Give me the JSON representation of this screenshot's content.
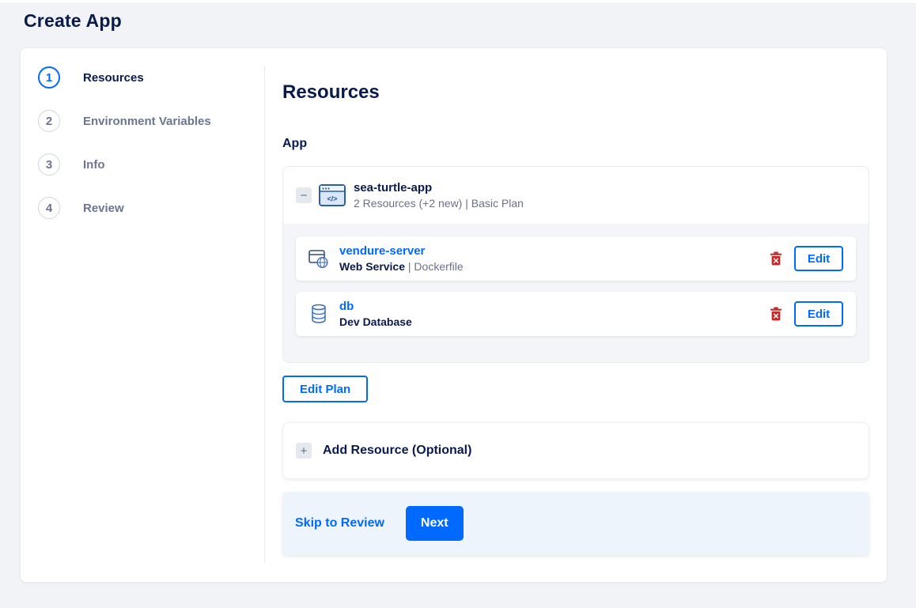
{
  "colors": {
    "accent_blue": "#0069ff",
    "heading_navy": "#081b4b",
    "muted_gray": "#67718a",
    "danger_red": "#c62828",
    "page_background": "#f1f3f6",
    "panel_gray": "#f3f5f9",
    "footer_blue": "#eef4fb"
  },
  "page": {
    "title": "Create App"
  },
  "wizard": {
    "steps": [
      {
        "number": "1",
        "label": "Resources",
        "state": "active"
      },
      {
        "number": "2",
        "label": "Environment Variables",
        "state": "upcoming"
      },
      {
        "number": "3",
        "label": "Info",
        "state": "upcoming"
      },
      {
        "number": "4",
        "label": "Review",
        "state": "upcoming"
      }
    ]
  },
  "content": {
    "heading": "Resources",
    "section_label": "App",
    "app_group": {
      "name": "sea-turtle-app",
      "summary": "2 Resources (+2 new) | Basic Plan",
      "resources": [
        {
          "name": "vendure-server",
          "type": "Web Service",
          "detail": " | Dockerfile",
          "icon": "web-service-icon",
          "edit_label": "Edit"
        },
        {
          "name": "db",
          "type": "Dev Database",
          "detail": "",
          "icon": "database-icon",
          "edit_label": "Edit"
        }
      ]
    },
    "edit_plan_label": "Edit Plan",
    "add_resource_label": "Add Resource (Optional)",
    "footer": {
      "skip_label": "Skip to Review",
      "next_label": "Next"
    }
  },
  "icons": {
    "collapse_glyph": "−",
    "add_glyph": "+",
    "app_glyph": "</>"
  }
}
